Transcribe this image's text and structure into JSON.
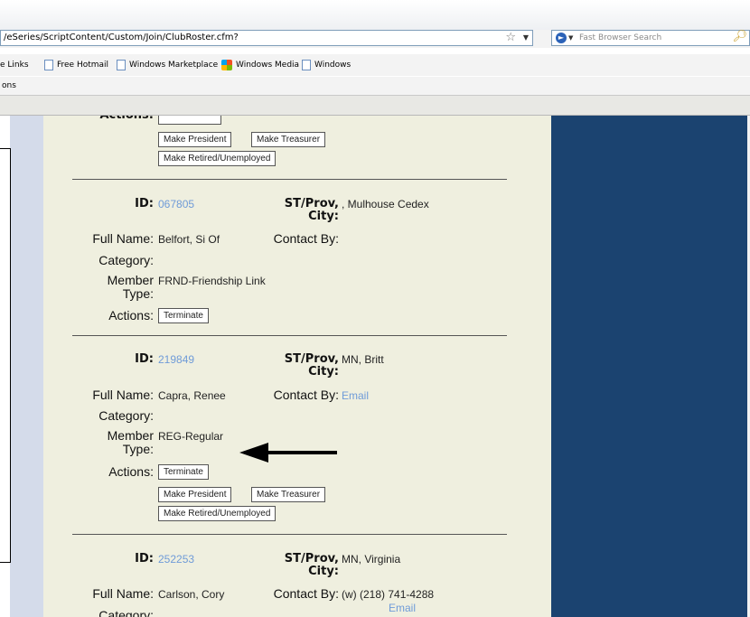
{
  "browser": {
    "address": "/eSeries/ScriptContent/Custom/Join/ClubRoster.cfm?",
    "search_placeholder": "Fast Browser Search",
    "links": [
      {
        "label": "e Links",
        "icon": "none"
      },
      {
        "label": "Free Hotmail",
        "icon": "page-icon"
      },
      {
        "label": "Windows Marketplace",
        "icon": "page-icon"
      },
      {
        "label": "Windows Media",
        "icon": "windows-media-icon"
      },
      {
        "label": "Windows",
        "icon": "page-icon"
      }
    ],
    "tools_text": "ons"
  },
  "roster": {
    "labels": {
      "id": "ID:",
      "st_prov": "ST/Prov,",
      "city": "City:",
      "full_name": "Full Name:",
      "contact_by": "Contact By:",
      "category": "Category:",
      "member": "Member",
      "type": "Type:",
      "actions": "Actions:"
    },
    "buttons": {
      "terminate": "Terminate",
      "make_president": "Make President",
      "make_treasurer": "Make Treasurer",
      "make_retired": "Make Retired/Unemployed"
    },
    "members": [
      {
        "id": "067805",
        "st_prov_city": ", Mulhouse Cedex",
        "full_name": "Belfort, Si Of",
        "contact_by": "",
        "member_type": "FRND-Friendship Link"
      },
      {
        "id": "219849",
        "st_prov_city": "MN, Britt",
        "full_name": "Capra, Renee",
        "contact_by": "Email",
        "member_type": "REG-Regular"
      },
      {
        "id": "252253",
        "st_prov_city": "MN, Virginia",
        "full_name": "Carlson, Cory",
        "contact_by_phone": "(w) (218) 741-4288",
        "contact_by": "Email",
        "category": "Category:"
      }
    ]
  },
  "colors": {
    "content_bg": "#efefdf",
    "right_panel": "#1b4370",
    "left_band": "#d4dbea",
    "link": "#6f9bd8"
  }
}
